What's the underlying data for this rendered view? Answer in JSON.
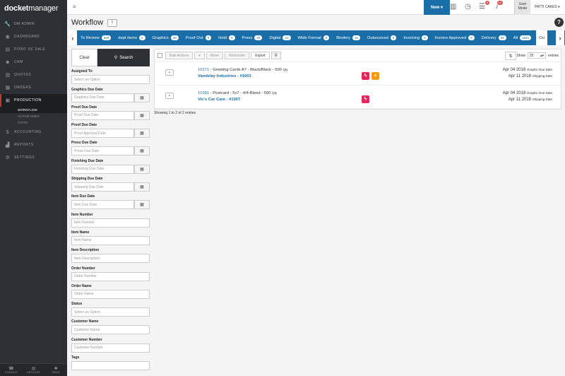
{
  "app": {
    "logo_bold": "docket",
    "logo_light": "manager"
  },
  "sidebar": {
    "items": [
      {
        "label": "DM Admin",
        "icon": "wrench-icon"
      },
      {
        "label": "Dashboard",
        "icon": "dashboard-icon"
      },
      {
        "label": "Point of Sale",
        "icon": "pos-icon"
      },
      {
        "label": "CRM",
        "icon": "users-icon"
      },
      {
        "label": "Quotes",
        "icon": "quotes-icon"
      },
      {
        "label": "Orders",
        "icon": "orders-icon"
      },
      {
        "label": "Production",
        "icon": "production-icon"
      }
    ],
    "sub_items": [
      "Workflow",
      "Active User",
      "Stats"
    ],
    "items2": [
      {
        "label": "Accounting",
        "icon": "dollar-icon"
      },
      {
        "label": "Reports",
        "icon": "chart-icon"
      },
      {
        "label": "Settings",
        "icon": "gear-icon"
      }
    ],
    "footer": [
      "Contact",
      "Articles",
      "Issue"
    ]
  },
  "topbar": {
    "new_label": "New ▾",
    "tasks_badge": "5",
    "notif_badge": "12",
    "user_mode_1": "User",
    "user_mode_2": "Mode",
    "user_name": "PATTI CAKES ▾"
  },
  "page": {
    "title": "Workflow"
  },
  "tabs": [
    {
      "label": "To Review",
      "count": "829"
    },
    {
      "label": "dept items",
      "count": "2"
    },
    {
      "label": "Graphics",
      "count": "28"
    },
    {
      "label": "Proof Out",
      "count": "9"
    },
    {
      "label": "Hold",
      "count": "6"
    },
    {
      "label": "Press",
      "count": "25"
    },
    {
      "label": "Digital",
      "count": "10"
    },
    {
      "label": "Wide Format",
      "count": "5"
    },
    {
      "label": "Bindery",
      "count": "16"
    },
    {
      "label": "Outsourced",
      "count": "8"
    },
    {
      "label": "Invoicing",
      "count": "6"
    },
    {
      "label": "Invoice Approved",
      "count": "6"
    },
    {
      "label": "Delivery",
      "count": "25"
    },
    {
      "label": "All",
      "count": "1541"
    }
  ],
  "tab_cut_label": "Ou",
  "filters": {
    "clear": "Clear",
    "search": "Search",
    "fields": [
      {
        "label": "Assigned To",
        "placeholder": "Select an Option",
        "date": false
      },
      {
        "label": "Graphics Due Date",
        "placeholder": "Graphics Due Date",
        "date": true
      },
      {
        "label": "Proof Due Date",
        "placeholder": "Proof Due Date",
        "date": true
      },
      {
        "label": "Proof Due Date",
        "placeholder": "Proof Approval Date",
        "date": true
      },
      {
        "label": "Press Due Date",
        "placeholder": "Press Due Date",
        "date": true
      },
      {
        "label": "Finishing Due Date",
        "placeholder": "Finishing Due Date",
        "date": true
      },
      {
        "label": "Shipping Due Date",
        "placeholder": "Shipping Due Date",
        "date": true
      },
      {
        "label": "Item Due Date",
        "placeholder": "Item Due Date",
        "date": true
      },
      {
        "label": "Item Number",
        "placeholder": "Item Number",
        "date": false
      },
      {
        "label": "Item Name",
        "placeholder": "Item Name",
        "date": false
      },
      {
        "label": "Item Description",
        "placeholder": "Item Description",
        "date": false
      },
      {
        "label": "Order Number",
        "placeholder": "Order Number",
        "date": false
      },
      {
        "label": "Order Name",
        "placeholder": "Order Name",
        "date": false
      },
      {
        "label": "Status",
        "placeholder": "Select an Option",
        "date": false
      },
      {
        "label": "Customer Name",
        "placeholder": "Customer Name",
        "date": false
      },
      {
        "label": "Customer Number",
        "placeholder": "Customer Number",
        "date": false
      },
      {
        "label": "Tags",
        "placeholder": "",
        "date": false
      }
    ]
  },
  "toolbar": {
    "bulk": "Bulk Actions",
    "move": "Move",
    "workorder": "Workorder",
    "export": "Export",
    "show": "Show",
    "show_value": "25",
    "entries": "entries"
  },
  "rows": [
    {
      "job": "10271",
      "desc": " - Greeting Cards A7 - Black/Black - 500 ",
      "qty": "Qty",
      "customer": "Vandelay Industries - #1003",
      "date1": "Apr 04 2018",
      "date1_label": "Graphic Due Date",
      "date2": "Apr 11 2018",
      "date2_label": "Shipping Date",
      "icons": [
        {
          "name": "bolt-icon",
          "color": "#e8245c",
          "glyph": "ϟ"
        },
        {
          "name": "plus-icon",
          "color": "#f39c12",
          "glyph": "+"
        }
      ]
    },
    {
      "job": "10281",
      "desc": " - Postcard - 5x7 - 4/4-Bleed - 500 ",
      "qty": "Qty",
      "customer": "Vic's Car Care - #1007",
      "date1": "Apr 04 2018",
      "date1_label": "Graphic Due Date",
      "date2": "Apr 11 2018",
      "date2_label": "Shipping Date",
      "icons": [
        {
          "name": "bolt-icon",
          "color": "#e8245c",
          "glyph": "ϟ"
        }
      ]
    }
  ],
  "info": "Showing 1 to 2 of 2 entries"
}
